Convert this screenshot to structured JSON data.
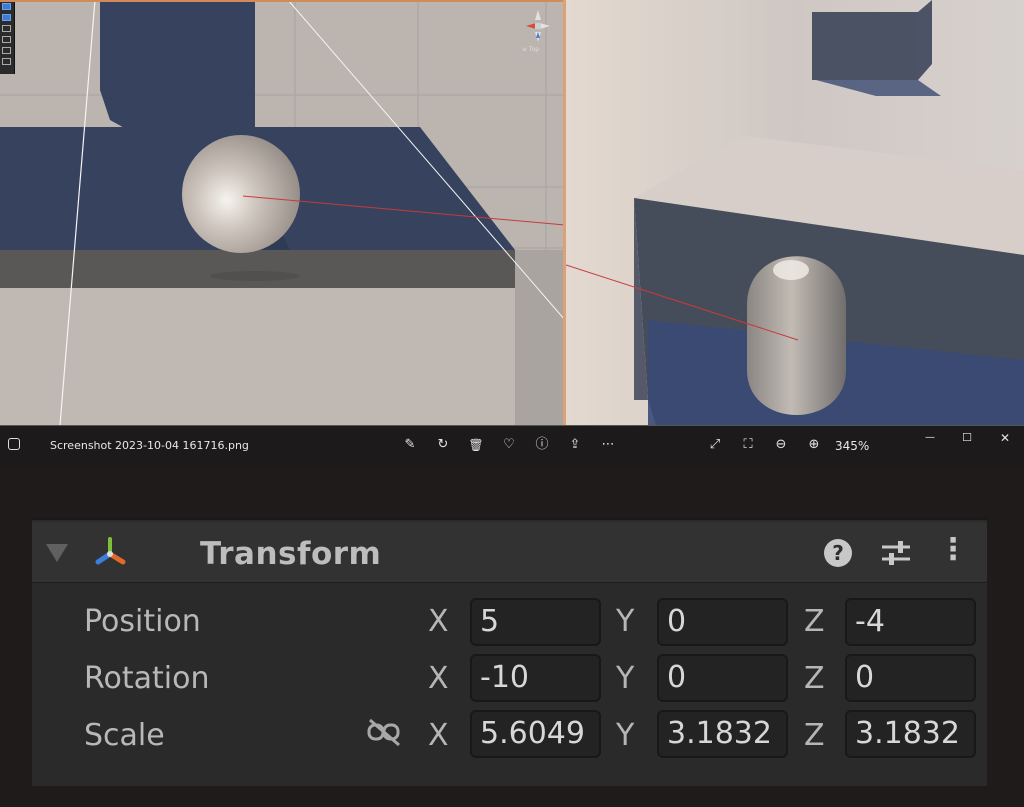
{
  "scene_view": {
    "gizmo_label": "≡ Top",
    "tools": [
      "hand-tool",
      "move-tool",
      "rotate-tool",
      "scale-tool",
      "rect-tool",
      "transform-tool"
    ]
  },
  "photos_bar": {
    "file_name": "Screenshot 2023-10-04 161716.png",
    "zoom_level": "345%",
    "icons": {
      "edit": "✎",
      "rotate": "↻",
      "delete": "🗑",
      "favorite": "♡",
      "info": "ⓘ",
      "share": "⇪",
      "more": "⋯",
      "fullscreen": "⤢",
      "fit": "⛶",
      "zoom_out": "⊖",
      "zoom_in": "⊕",
      "minimize": "—",
      "maximize": "☐",
      "close": "✕"
    }
  },
  "inspector": {
    "component_title": "Transform",
    "help_glyph": "?",
    "more_glyph": "⋮",
    "rows": {
      "position": {
        "label": "Position",
        "x": "5",
        "y": "0",
        "z": "-4"
      },
      "rotation": {
        "label": "Rotation",
        "x": "-10",
        "y": "0",
        "z": "0"
      },
      "scale": {
        "label": "Scale",
        "x": "5.6049",
        "y": "3.1832",
        "z": "3.1832"
      }
    },
    "axis": {
      "x": "X",
      "y": "Y",
      "z": "Z"
    }
  }
}
